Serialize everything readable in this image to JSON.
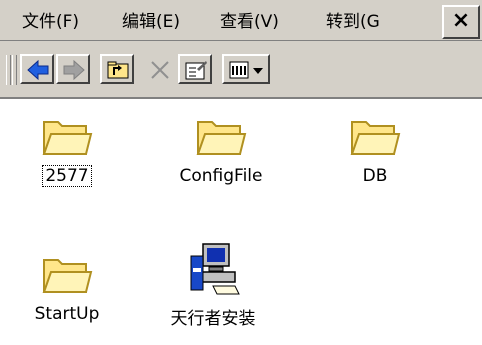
{
  "menu": {
    "file": "文件(F)",
    "edit": "编辑(E)",
    "view": "查看(V)",
    "goto": "转到(G",
    "close": "×"
  },
  "items": [
    {
      "label": "2577",
      "icon": "folder-icon"
    },
    {
      "label": "ConfigFile",
      "icon": "folder-icon"
    },
    {
      "label": "DB",
      "icon": "folder-icon"
    },
    {
      "label": "StartUp",
      "icon": "folder-icon"
    },
    {
      "label": "天行者安装",
      "icon": "computer-setup-icon"
    }
  ],
  "colors": {
    "folder_fill": "#ffe68a",
    "folder_edge": "#b09020",
    "chrome": "#d4d0c8",
    "back_blue": "#2060e0"
  }
}
